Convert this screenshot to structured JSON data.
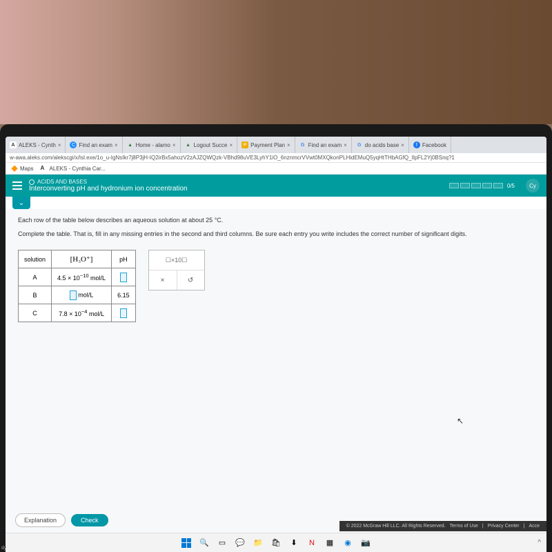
{
  "tabs": [
    {
      "favclass": "fav-a",
      "fav": "A",
      "label": "ALEKS - Cynth"
    },
    {
      "favclass": "fav-c",
      "fav": "C",
      "label": "Find an exam"
    },
    {
      "favclass": "fav-hat",
      "fav": "▲",
      "label": "Home - alamo"
    },
    {
      "favclass": "fav-hat",
      "fav": "▲",
      "label": "Logout Succe"
    },
    {
      "favclass": "fav-p",
      "fav": "P",
      "label": "Payment Plan"
    },
    {
      "favclass": "fav-g",
      "fav": "G",
      "label": "Find an exam"
    },
    {
      "favclass": "fav-g",
      "fav": "G",
      "label": "do acids base"
    },
    {
      "favclass": "fav-fb",
      "fav": "f",
      "label": "Facebook"
    }
  ],
  "url": "w-awa.aleks.com/alekscgi/x/Isl.exe/1o_u-IgNsIkr7j8P3jH-IQ2irBx5ahozV2zAJZQWQzk-VBhd98uVE3LyhY1iO_6nznmcrVVwt0MXQkonPLHidEMuQ5yqHtTHbAGfQ_IlpFL2Yj0BSnq?1",
  "bookmarks": [
    {
      "icon": "🔶",
      "label": "Maps"
    },
    {
      "icon": "A",
      "label": "ALEKS - Cynthia Car..."
    }
  ],
  "topic": {
    "category": "ACIDS AND BASES",
    "title": "Interconverting pH and hydronium ion concentration",
    "progress": "0/5",
    "avatar": "Cy"
  },
  "question": {
    "p1": "Each row of the table below describes an aqueous solution at about 25 °C.",
    "p2": "Complete the table. That is, fill in any missing entries in the second and third columns. Be sure each entry you write includes the correct number of significant digits."
  },
  "table": {
    "h_sol": "solution",
    "h_h3o": "[H₃O⁺]",
    "h_ph": "pH",
    "rows": [
      {
        "sol": "A",
        "h3o_pre": "4.5 × 10",
        "h3o_exp": "−10",
        "h3o_unit": " mol/L",
        "ph_input": true
      },
      {
        "sol": "B",
        "h3o_input": true,
        "h3o_unit": " mol/L",
        "ph": "6.15"
      },
      {
        "sol": "C",
        "h3o_pre": "7.8 × 10",
        "h3o_exp": "−4",
        "h3o_unit": " mol/L",
        "ph_input": true
      }
    ]
  },
  "tools": {
    "sci": "☐×10☐",
    "times": "×",
    "undo": "↺"
  },
  "buttons": {
    "explanation": "Explanation",
    "check": "Check"
  },
  "footer": {
    "copy": "© 2022 McGraw Hill LLC. All Rights Reserved.",
    "terms": "Terms of Use",
    "privacy": "Privacy Center",
    "access": "Acce"
  },
  "corner": "dy"
}
